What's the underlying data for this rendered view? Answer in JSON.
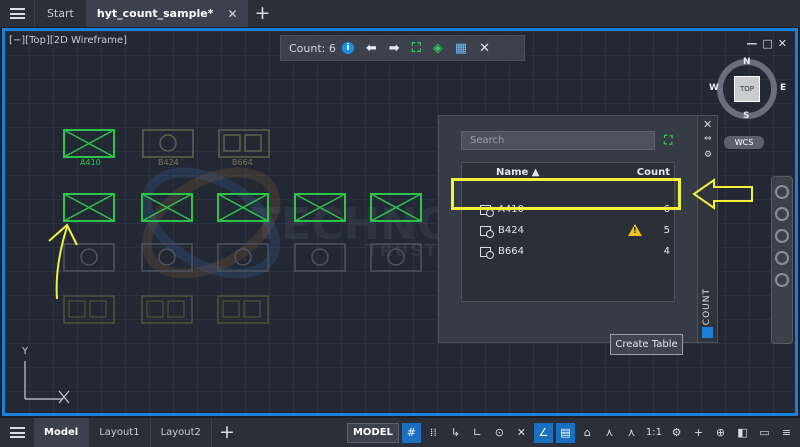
{
  "topbar": {
    "tabs": [
      {
        "label": "Start"
      },
      {
        "label": "hyt_count_sample*",
        "active": true
      }
    ],
    "close_glyph": "✕",
    "new_tab_glyph": "+"
  },
  "viewport": {
    "label": "[−][Top][2D Wireframe]",
    "controls": [
      "—",
      "□",
      "✕"
    ]
  },
  "count_toolbar": {
    "label": "Count:",
    "count": "6",
    "info_glyph": "i",
    "icons": [
      "arrow-left-icon",
      "arrow-right-icon",
      "zoom-extents-icon",
      "insert-block-icon",
      "create-table-icon",
      "close-icon"
    ]
  },
  "blocks": {
    "top_row_labels": [
      "A410",
      "B424",
      "B664"
    ],
    "top_row_colors": [
      "#2ec44a",
      "#6b6f52",
      "#6b6f52"
    ]
  },
  "viewcube": {
    "north": "N",
    "south": "S",
    "east": "E",
    "west": "W",
    "face": "TOP",
    "wcs": "WCS"
  },
  "watermark": {
    "tagline": "TRUSTED EVERYTHING"
  },
  "count_palette": {
    "search_placeholder": "Search",
    "columns": {
      "name": "Name ▲",
      "count": "Count"
    },
    "rows": [
      {
        "name": "A410",
        "count": "6",
        "warning": false
      },
      {
        "name": "B424",
        "count": "5",
        "warning": true
      },
      {
        "name": "B664",
        "count": "4",
        "warning": false
      }
    ],
    "warning_glyph": "!",
    "create_table": "Create Table",
    "side_title": "COUNT",
    "side_close": "✕"
  },
  "ucs": {
    "y": "Y"
  },
  "statusbar": {
    "layouts": [
      {
        "label": "Model",
        "active": true
      },
      {
        "label": "Layout1"
      },
      {
        "label": "Layout2"
      }
    ],
    "add_glyph": "+",
    "model_label": "MODEL",
    "scale": "1:1",
    "accent": "#1a7fd6",
    "highlight": "#f4f13a"
  }
}
